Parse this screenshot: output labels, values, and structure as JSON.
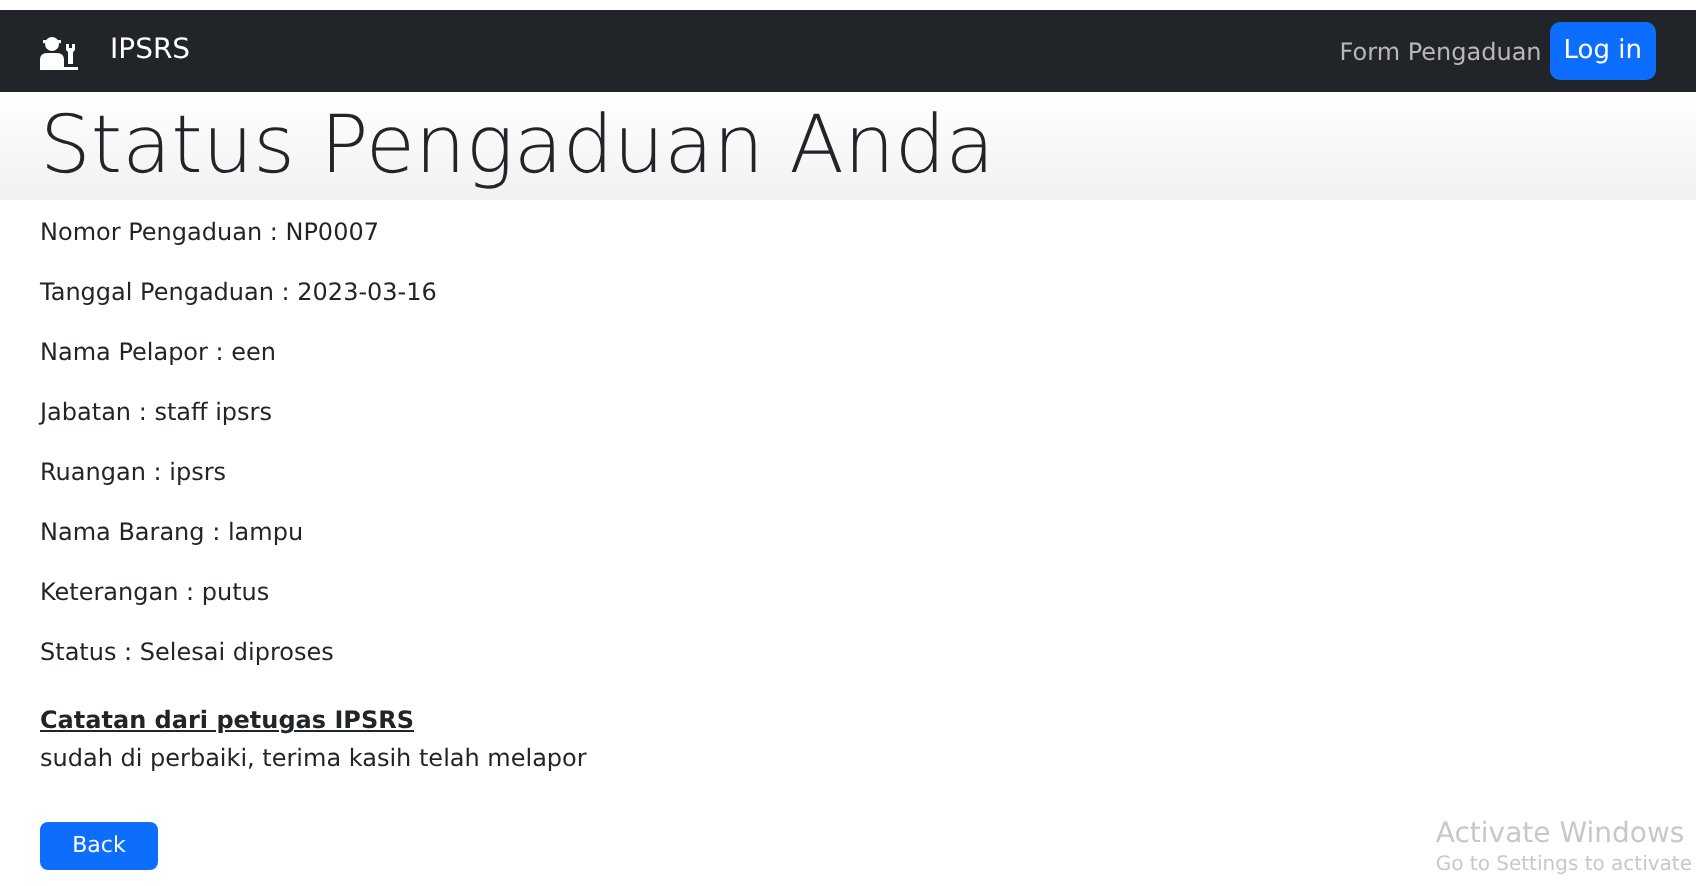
{
  "navbar": {
    "brand": "IPSRS",
    "links": [
      {
        "label": "Form Pengaduan",
        "kind": "link"
      },
      {
        "label": "Log in",
        "kind": "button"
      }
    ]
  },
  "heading": "Status Pengaduan Anda",
  "fields": [
    {
      "text": "Nomor Pengaduan : NP0007"
    },
    {
      "text": "Tanggal Pengaduan : 2023-03-16"
    },
    {
      "text": "Nama Pelapor : een"
    },
    {
      "text": "Jabatan : staff ipsrs"
    },
    {
      "text": "Ruangan : ipsrs"
    },
    {
      "text": "Nama Barang : lampu"
    },
    {
      "text": "Keterangan : putus"
    },
    {
      "text": "Status : Selesai diproses"
    }
  ],
  "note": {
    "title": "Catatan dari petugas IPSRS",
    "text": "sudah di perbaiki, terima kasih telah melapor"
  },
  "back_button": "Back",
  "os_notice": {
    "title": "Activate Windows",
    "subtitle": "Go to Settings to activate"
  }
}
